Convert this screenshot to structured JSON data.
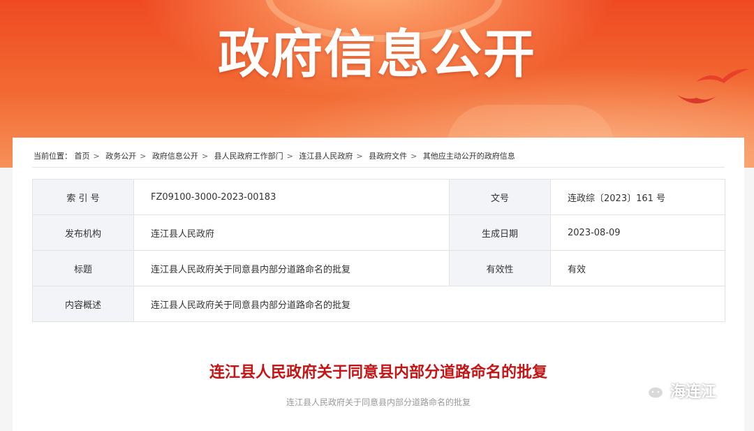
{
  "banner": {
    "title": "政府信息公开"
  },
  "breadcrumb": {
    "prefix": "当前位置：",
    "items": [
      "首页",
      "政务公开",
      "政府信息公开",
      "县人民政府工作部门",
      "连江县人民政府",
      "县政府文件",
      "其他应主动公开的政府信息"
    ],
    "separator": ">"
  },
  "info_table": {
    "index_label": "索 引 号",
    "index_value": "FZ09100-3000-2023-00183",
    "docno_label": "文号",
    "docno_value": "连政综〔2023〕161 号",
    "publisher_label": "发布机构",
    "publisher_value": "连江县人民政府",
    "date_label": "生成日期",
    "date_value": "2023-08-09",
    "title_label": "标题",
    "title_value": "连江县人民政府关于同意县内部分道路命名的批复",
    "validity_label": "有效性",
    "validity_value": "有效",
    "summary_label": "内容概述",
    "summary_value": "连江县人民政府关于同意县内部分道路命名的批复"
  },
  "document": {
    "title": "连江县人民政府关于同意县内部分道路命名的批复",
    "subtitle": "连江县人民政府关于同意县内部分道路命名的批复"
  },
  "watermark": {
    "label": "海连江",
    "icon": "wechat-icon"
  },
  "colors": {
    "banner": "#ef4a22",
    "doc_title": "#c41414",
    "label_bg": "#f3f4f7"
  }
}
